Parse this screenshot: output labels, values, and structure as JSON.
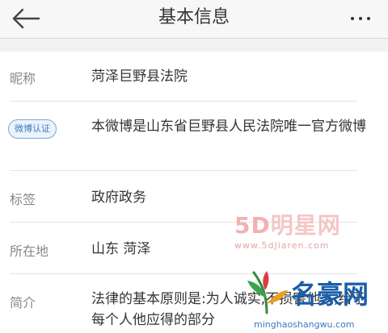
{
  "header": {
    "title": "基本信息",
    "back_icon": "arrow-left-icon",
    "more_icon": "more-horizontal-icon"
  },
  "rows": [
    {
      "label": "昵称",
      "value": "菏泽巨野县法院"
    },
    {
      "badge": "微博认证",
      "value": "本微博是山东省巨野县人民法院唯一官方微博"
    },
    {
      "label": "标签",
      "value": "政府政务"
    },
    {
      "label": "所在地",
      "value": "山东 菏泽"
    },
    {
      "label": "简介",
      "value": "法律的基本原则是:为人诚实,不损害他人,给予每个人他应得的部分"
    }
  ],
  "watermarks": {
    "first": {
      "part1": "5D",
      "part2": "明星网",
      "url": "www.5dJiaren.com"
    },
    "second": {
      "name": "名豪网",
      "url": "minghaoshangwu.com"
    }
  },
  "colors": {
    "badge_text": "#3f7bc0",
    "badge_border": "#7ba9d8",
    "label": "#888888",
    "value": "#333333"
  }
}
